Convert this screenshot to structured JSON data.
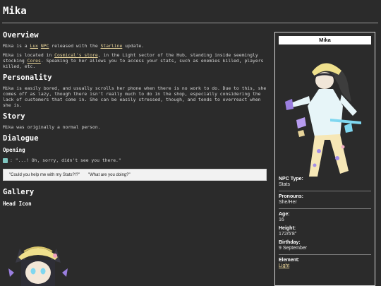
{
  "page": {
    "title": "Mika"
  },
  "overview": {
    "heading": "Overview",
    "p1_a": "Mika is a ",
    "p1_link1": "Lux",
    "p1_b": " ",
    "p1_link2": "NPC",
    "p1_c": " released with the ",
    "p1_link3": "Starline",
    "p1_d": " update.",
    "p2_a": "Mika is located in ",
    "p2_link1": "Cosmical's store",
    "p2_b": ", in the Light sector of the Hub, standing inside seemingly stocking ",
    "p2_link2": "Cores",
    "p2_c": ". Speaking to her allows you to access your stats, such as enemies killed, players killed, etc."
  },
  "personality": {
    "heading": "Personality",
    "text": "Mika is easily bored, and usually scrolls her phone when there is no work to do. Due to this, she comes off as lazy, though there isn't really much to do in the shop, especially considering the lack of customers that come in. She can be easily stressed, though, and tends to overreact when she is."
  },
  "story": {
    "heading": "Story",
    "text": "Mika was originally a normal person."
  },
  "dialogue": {
    "heading": "Dialogue",
    "subheading": "Opening",
    "line": ": \"...! Oh, sorry, didn't see you there.\"",
    "options": [
      "\"Could you help me with my Stats?!?\"",
      "\"What are you doing?\""
    ]
  },
  "gallery": {
    "heading": "Gallery",
    "subheading": "Head Icon"
  },
  "infobox": {
    "name": "Mika",
    "fields": [
      {
        "label": "NPC Type:",
        "value": "Stats"
      },
      {
        "label": "Pronouns:",
        "value": "She/Her"
      },
      {
        "label": "Age:",
        "value": "16"
      },
      {
        "label": "Height:",
        "value": "172/5'8\""
      },
      {
        "label": "Birthday:",
        "value": "9 September"
      },
      {
        "label": "Element:",
        "value": "Light"
      }
    ]
  },
  "colors": {
    "background": "#2b2b2b",
    "link": "#e8d49a",
    "text": "#e6e6e6"
  }
}
